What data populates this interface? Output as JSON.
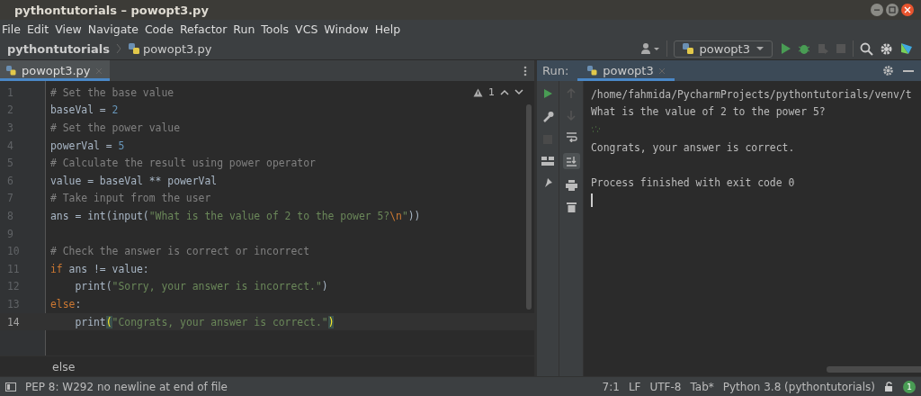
{
  "window": {
    "title": "pythontutorials – powopt3.py"
  },
  "menu": [
    "File",
    "Edit",
    "View",
    "Navigate",
    "Code",
    "Refactor",
    "Run",
    "Tools",
    "VCS",
    "Window",
    "Help"
  ],
  "breadcrumb": {
    "project": "pythontutorials",
    "file": "powopt3.py"
  },
  "run_config": "powopt3",
  "editor_tabs": [
    {
      "label": "powopt3.py",
      "selected": true
    }
  ],
  "inspection": {
    "count": "1"
  },
  "code": [
    {
      "number": "1",
      "current": false,
      "tokens": [
        {
          "kind": "comment",
          "text": "# Set the base value"
        }
      ]
    },
    {
      "number": "2",
      "current": false,
      "tokens": [
        {
          "kind": "plain",
          "text": "baseVal = "
        },
        {
          "kind": "number",
          "text": "2"
        }
      ]
    },
    {
      "number": "3",
      "current": false,
      "tokens": [
        {
          "kind": "comment",
          "text": "# Set the power value"
        }
      ]
    },
    {
      "number": "4",
      "current": false,
      "tokens": [
        {
          "kind": "plain",
          "text": "powerVal = "
        },
        {
          "kind": "number",
          "text": "5"
        }
      ]
    },
    {
      "number": "5",
      "current": false,
      "tokens": [
        {
          "kind": "comment",
          "text": "# Calculate the result using power operator"
        }
      ]
    },
    {
      "number": "6",
      "current": false,
      "tokens": [
        {
          "kind": "plain",
          "text": "value = baseVal ** powerVal"
        }
      ]
    },
    {
      "number": "7",
      "current": false,
      "tokens": [
        {
          "kind": "comment",
          "text": "# Take input from the user"
        }
      ]
    },
    {
      "number": "8",
      "current": false,
      "tokens": [
        {
          "kind": "plain",
          "text": "ans = int(input("
        },
        {
          "kind": "string",
          "text": "\"What is the value of 2 to the power 5?"
        },
        {
          "kind": "escape",
          "text": "\\n"
        },
        {
          "kind": "string",
          "text": "\""
        },
        {
          "kind": "plain",
          "text": "))"
        }
      ]
    },
    {
      "number": "9",
      "current": false
    },
    {
      "number": "10",
      "current": false,
      "tokens": [
        {
          "kind": "comment",
          "text": "# Check the answer is correct or incorrect"
        }
      ]
    },
    {
      "number": "11",
      "current": false,
      "tokens": [
        {
          "kind": "keyword",
          "text": "if"
        },
        {
          "kind": "plain",
          "text": " ans != value:"
        }
      ]
    },
    {
      "number": "12",
      "current": false,
      "tokens": [
        {
          "kind": "plain",
          "text": "    print("
        },
        {
          "kind": "string",
          "text": "\"Sorry, your answer is incorrect.\""
        },
        {
          "kind": "plain",
          "text": ")"
        }
      ]
    },
    {
      "number": "13",
      "current": false,
      "tokens": [
        {
          "kind": "keyword",
          "text": "else"
        },
        {
          "kind": "plain",
          "text": ":"
        }
      ]
    },
    {
      "number": "14",
      "current": true,
      "tokens": [
        {
          "kind": "plain",
          "text": "    print"
        },
        {
          "kind": "brace",
          "text": "("
        },
        {
          "kind": "string",
          "text": "\"Congrats, your answer is correct.\""
        },
        {
          "kind": "brace",
          "text": ")"
        }
      ]
    }
  ],
  "code_breadcrumb": "else",
  "run_panel": {
    "label": "Run:",
    "tab": {
      "label": "powopt3",
      "selected": true
    },
    "output": [
      {
        "kind": "plain",
        "text": "/home/fahmida/PycharmProjects/pythontutorials/venv/t"
      },
      {
        "kind": "plain",
        "text": "What is the value of 2 to the power 5?"
      },
      {
        "kind": "input"
      },
      {
        "kind": "plain",
        "text": "Congrats, your answer is correct."
      },
      {
        "kind": "blank"
      },
      {
        "kind": "plain",
        "text": "Process finished with exit code 0"
      },
      {
        "kind": "caret"
      }
    ]
  },
  "status_bar": {
    "message": "PEP 8: W292 no newline at end of file",
    "items": [
      "7:1",
      "LF",
      "UTF-8",
      "Tab*",
      "Python 3.8 (pythontutorials)"
    ],
    "notifications": "1"
  }
}
